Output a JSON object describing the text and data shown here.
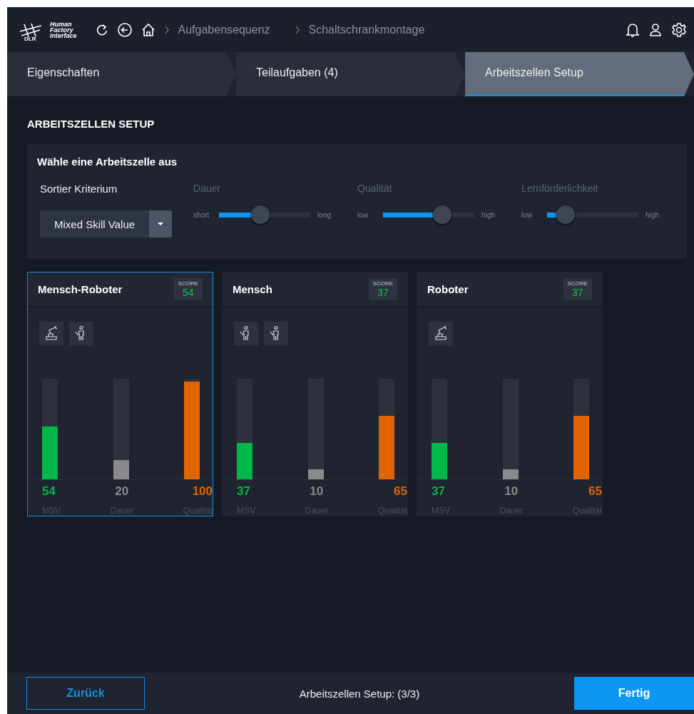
{
  "header": {
    "logo_text": [
      "Human",
      "Factory",
      "Interface"
    ],
    "logo_mark": "DLR",
    "breadcrumbs": [
      "Aufgabensequenz",
      "Schaltschrankmontage"
    ]
  },
  "tabs": [
    {
      "label": "Eigenschaften",
      "selected": false
    },
    {
      "label": "Teilaufgaben (4)",
      "selected": false
    },
    {
      "label": "Arbeitszellen Setup",
      "selected": true
    }
  ],
  "section_title": "ARBEITSZELLEN SETUP",
  "panel": {
    "title": "Wähle eine Arbeitszelle aus",
    "sort_label": "Sortier Kriterium",
    "sort_value": "Mixed Skill Value",
    "sliders": [
      {
        "label": "Dauer",
        "min_label": "short",
        "max_label": "long",
        "level": 0.45
      },
      {
        "label": "Qualität",
        "min_label": "low",
        "max_label": "high",
        "level": 0.65
      },
      {
        "label": "Lernförderlichkeit",
        "min_label": "low",
        "max_label": "high",
        "level": 0.2
      }
    ]
  },
  "cells": [
    {
      "title": "Mensch-Roboter",
      "score_label": "SCORE",
      "score": "54",
      "selected": true,
      "agents": [
        {
          "kind": "robot"
        },
        {
          "kind": "human"
        }
      ],
      "bars": [
        {
          "value": "54",
          "label": "MSV",
          "level": 0.54,
          "color": "#00b84a"
        },
        {
          "value": "20",
          "label": "Dauer",
          "level": 0.2,
          "color": "#8a8a8a"
        },
        {
          "value": "100",
          "label": "Qualität",
          "level": 1,
          "color": "#e06400"
        }
      ]
    },
    {
      "title": "Mensch",
      "score_label": "SCORE",
      "score": "37",
      "selected": false,
      "agents": [
        {
          "kind": "human"
        },
        {
          "kind": "human"
        }
      ],
      "bars": [
        {
          "value": "37",
          "label": "MSV",
          "level": 0.37,
          "color": "#00b84a"
        },
        {
          "value": "10",
          "label": "Dauer",
          "level": 0.1,
          "color": "#8a8a8a"
        },
        {
          "value": "65",
          "label": "Qualität",
          "level": 0.65,
          "color": "#e06400"
        }
      ]
    },
    {
      "title": "Roboter",
      "score_label": "SCORE",
      "score": "37",
      "selected": false,
      "agents": [
        {
          "kind": "robot"
        }
      ],
      "bars": [
        {
          "value": "37",
          "label": "MSV",
          "level": 0.37,
          "color": "#00b84a"
        },
        {
          "value": "10",
          "label": "Dauer",
          "level": 0.1,
          "color": "#8a8a8a"
        },
        {
          "value": "65",
          "label": "Qualität",
          "level": 0.65,
          "color": "#e06400"
        }
      ]
    }
  ],
  "footer": {
    "back_button": "Zurück",
    "status": "Arbeitszellen Setup: (3/3)",
    "done_button": "Fertig"
  }
}
